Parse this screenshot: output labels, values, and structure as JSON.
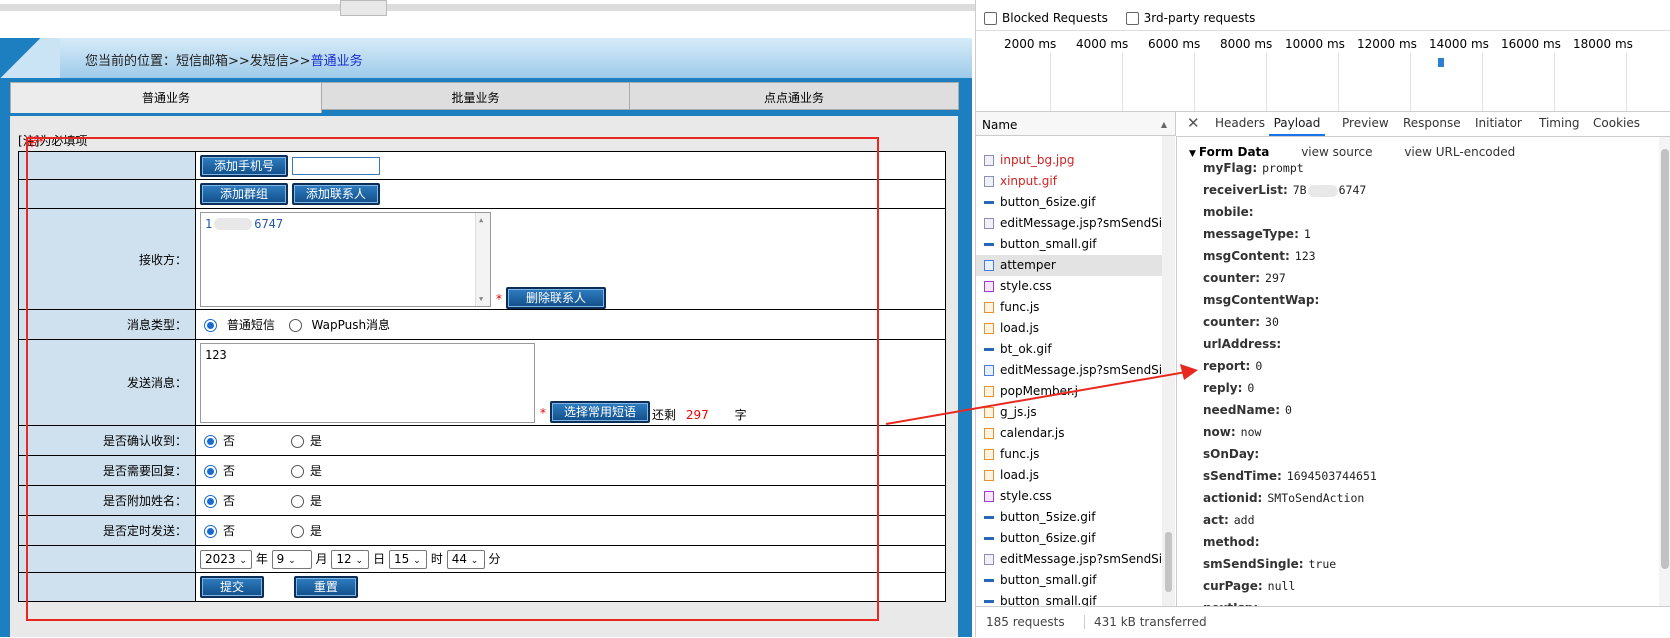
{
  "breadcrumb": {
    "prefix": "您当前的位置：短信邮箱>>发短信>>",
    "current": "普通业务"
  },
  "tabs": [
    "普通业务",
    "批量业务",
    "点点通业务"
  ],
  "note": {
    "bracket_open": "[",
    "label": "注]",
    "star": "带*",
    "text": "为必填项"
  },
  "form": {
    "add_phone_btn": "添加手机号",
    "add_group_btn": "添加群组",
    "add_contact_btn": "添加联系人",
    "receiver_label": "接收方：",
    "receiver_value_start": "1",
    "receiver_value_end": "6747",
    "delete_contact_btn": "删除联系人",
    "msg_type_label": "消息类型：",
    "msg_type_options": [
      "普通短信",
      "WapPush消息"
    ],
    "send_msg_label": "发送消息：",
    "msg_content": "123",
    "common_sms_btn": "选择常用短语",
    "remaining_prefix": "还剩",
    "remaining_count": "297",
    "remaining_suffix": "字",
    "confirm_label": "是否确认收到：",
    "reply_label": "是否需要回复：",
    "attach_name_label": "是否附加姓名：",
    "scheduled_label": "是否定时发送：",
    "no": "否",
    "yes": "是",
    "date": {
      "year": "2023",
      "year_unit": "年",
      "month": "9",
      "month_unit": "月",
      "day": "12",
      "day_unit": "日",
      "hour": "15",
      "hour_unit": "时",
      "minute": "44",
      "minute_unit": "分"
    },
    "submit_btn": "提交",
    "reset_btn": "重置",
    "required_star": "*"
  },
  "devtools": {
    "filters": [
      "Blocked Requests",
      "3rd-party requests"
    ],
    "timeline_ticks": [
      "2000 ms",
      "4000 ms",
      "6000 ms",
      "8000 ms",
      "10000 ms",
      "12000 ms",
      "14000 ms",
      "16000 ms",
      "18000 ms"
    ],
    "name_header": "Name",
    "requests": [
      {
        "name": "input_bg.jpg",
        "icon": "image-icon",
        "error": true
      },
      {
        "name": "xinput.gif",
        "icon": "image-icon",
        "error": true
      },
      {
        "name": "button_6size.gif",
        "icon": "bar-icon",
        "error": false
      },
      {
        "name": "editMessage.jsp?smSendSi...",
        "icon": "image-icon",
        "error": false
      },
      {
        "name": "button_small.gif",
        "icon": "bar-icon",
        "error": false
      },
      {
        "name": "attemper",
        "icon": "document-icon",
        "error": false
      },
      {
        "name": "style.css",
        "icon": "css-icon",
        "error": false
      },
      {
        "name": "func.js",
        "icon": "js-icon",
        "error": false
      },
      {
        "name": "load.js",
        "icon": "js-icon",
        "error": false
      },
      {
        "name": "bt_ok.gif",
        "icon": "bar-icon",
        "error": false
      },
      {
        "name": "editMessage.jsp?smSendSi...",
        "icon": "document-icon",
        "error": false
      },
      {
        "name": "popMember.j",
        "icon": "js-icon",
        "error": false
      },
      {
        "name": "g_js.js",
        "icon": "js-icon",
        "error": false
      },
      {
        "name": "calendar.js",
        "icon": "js-icon",
        "error": false
      },
      {
        "name": "func.js",
        "icon": "js-icon",
        "error": false
      },
      {
        "name": "load.js",
        "icon": "js-icon",
        "error": false
      },
      {
        "name": "style.css",
        "icon": "css-icon",
        "error": false
      },
      {
        "name": "button_5size.gif",
        "icon": "bar-icon",
        "error": false
      },
      {
        "name": "button_6size.gif",
        "icon": "bar-icon",
        "error": false
      },
      {
        "name": "editMessage.jsp?smSendSi...",
        "icon": "image-icon",
        "error": false
      },
      {
        "name": "button_small.gif",
        "icon": "bar-icon",
        "error": false
      },
      {
        "name": "button_small.gif",
        "icon": "bar-icon",
        "error": false
      }
    ],
    "detail_tabs": [
      "Headers",
      "Payload",
      "Preview",
      "Response",
      "Initiator",
      "Timing",
      "Cookies"
    ],
    "active_tab": "Payload",
    "form_data_title": "Form Data",
    "view_source": "view source",
    "view_url_encoded": "view URL-encoded",
    "payload": [
      {
        "k": "myFlag:",
        "v": "prompt"
      },
      {
        "k": "receiverList:",
        "v": "7B",
        "v2": "6747"
      },
      {
        "k": "mobile:",
        "v": ""
      },
      {
        "k": "messageType:",
        "v": "1"
      },
      {
        "k": "msgContent:",
        "v": "123"
      },
      {
        "k": "counter:",
        "v": "297"
      },
      {
        "k": "msgContentWap:",
        "v": ""
      },
      {
        "k": "counter:",
        "v": "30"
      },
      {
        "k": "urlAddress:",
        "v": ""
      },
      {
        "k": "report:",
        "v": "0"
      },
      {
        "k": "reply:",
        "v": "0"
      },
      {
        "k": "needName:",
        "v": "0"
      },
      {
        "k": "now:",
        "v": "now"
      },
      {
        "k": "sOnDay:",
        "v": ""
      },
      {
        "k": "sSendTime:",
        "v": "1694503744651"
      },
      {
        "k": "actionid:",
        "v": "SMToSendAction"
      },
      {
        "k": "act:",
        "v": "add"
      },
      {
        "k": "method:",
        "v": ""
      },
      {
        "k": "smSendSingle:",
        "v": "true"
      },
      {
        "k": "curPage:",
        "v": "null"
      },
      {
        "k": "nextJsp:",
        "v": ""
      }
    ],
    "status_requests": "185 requests",
    "status_transferred": "431 kB transferred",
    "close_glyph": "✕",
    "caret_glyph": "▼"
  },
  "colors": {
    "accent": "#1a73e8",
    "annotation_red": "#e8281f",
    "page_blue": "#1e7fc0",
    "button_blue": "#114f8a"
  }
}
